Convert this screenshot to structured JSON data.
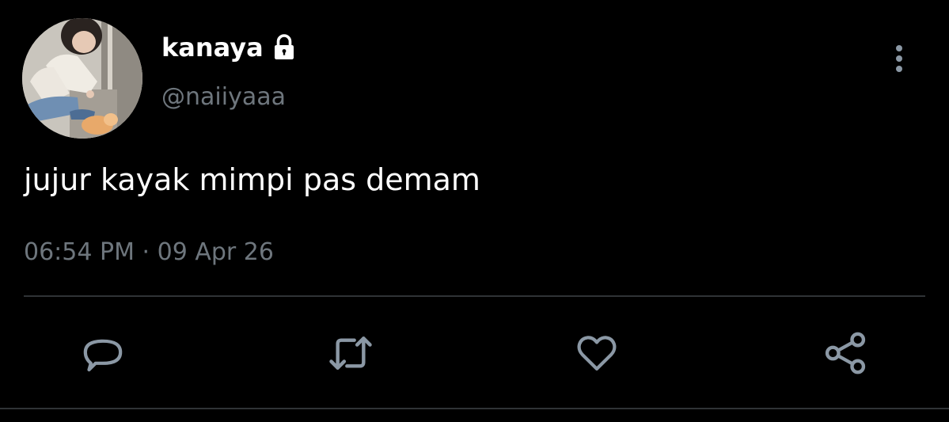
{
  "user": {
    "display_name": "kanaya",
    "handle": "@naiiyaaa",
    "protected_icon": "lock-icon",
    "avatar": "profile-photo"
  },
  "tweet": {
    "text": "jujur kayak mimpi pas demam",
    "time": "06:54 PM",
    "separator": "·",
    "date": "09 Apr 26"
  },
  "actions": {
    "reply_icon": "reply-icon",
    "retweet_icon": "retweet-icon",
    "like_icon": "heart-icon",
    "share_icon": "share-icon",
    "more_icon": "more-vertical-icon"
  },
  "colors": {
    "background": "#000000",
    "text": "#ffffff",
    "secondary": "#6e767d",
    "divider": "#2f3336",
    "icon": "#8b98a5"
  }
}
